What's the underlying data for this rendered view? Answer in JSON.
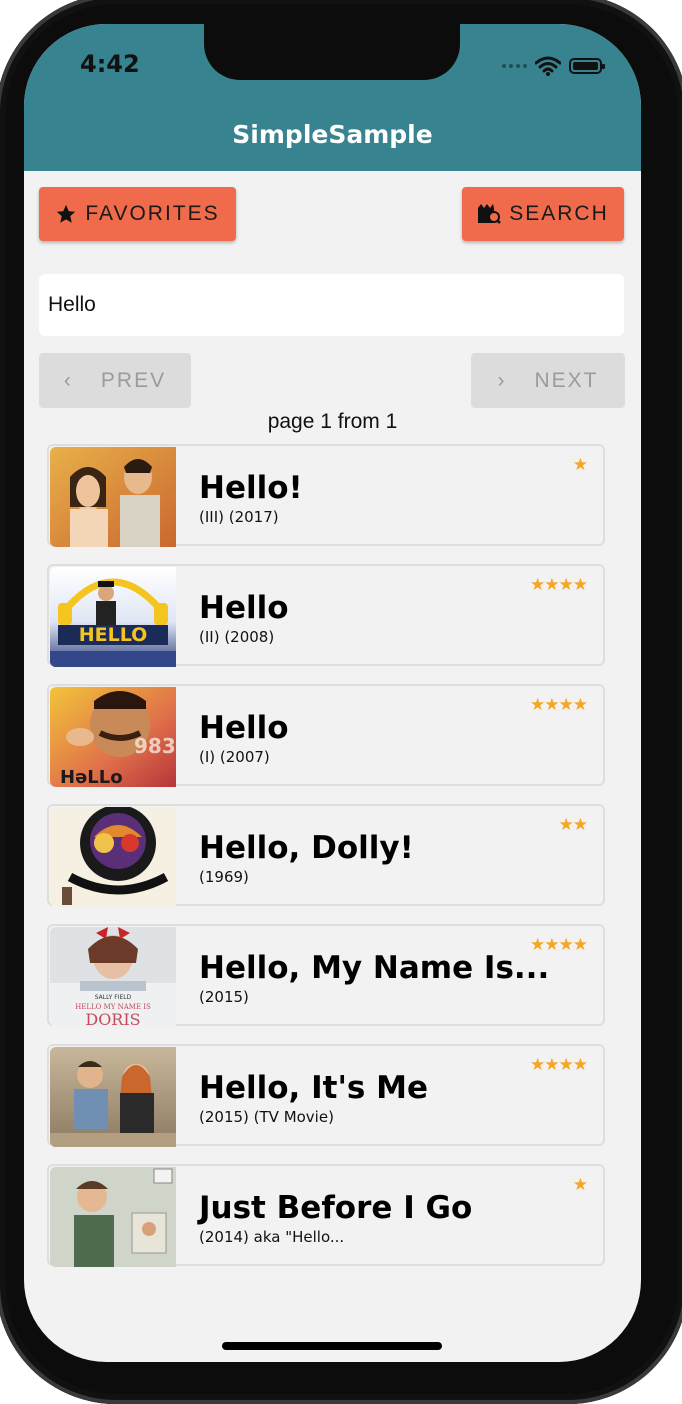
{
  "status_bar": {
    "time": "4:42"
  },
  "app": {
    "title": "SimpleSample"
  },
  "toolbar": {
    "favorites_label": "FAVORITES",
    "search_label": "SEARCH"
  },
  "search": {
    "value": "Hello"
  },
  "pagination": {
    "prev_label": "PREV",
    "next_label": "NEXT",
    "page_info": "page 1 from 1"
  },
  "movies": [
    {
      "title": "Hello!",
      "desc": "(III) (2017)",
      "stars": "★"
    },
    {
      "title": "Hello",
      "desc": "(II) (2008)",
      "stars": "★★★★"
    },
    {
      "title": "Hello",
      "desc": "(I) (2007)",
      "stars": "★★★★"
    },
    {
      "title": "Hello, Dolly!",
      "desc": "(1969)",
      "stars": "★★"
    },
    {
      "title": "Hello, My Name Is...",
      "desc": "(2015)",
      "stars": "★★★★"
    },
    {
      "title": "Hello, It's Me",
      "desc": "(2015) (TV Movie)",
      "stars": "★★★★"
    },
    {
      "title": "Just Before I Go",
      "desc": "(2014) aka \"Hello...",
      "stars": "★"
    }
  ],
  "colors": {
    "header": "#378390",
    "accent_button": "#f06b4c",
    "star": "#f5a623"
  },
  "icons": {
    "favorites": "star-icon",
    "search": "film-search-icon",
    "prev": "chevron-left-icon",
    "next": "chevron-right-icon"
  }
}
